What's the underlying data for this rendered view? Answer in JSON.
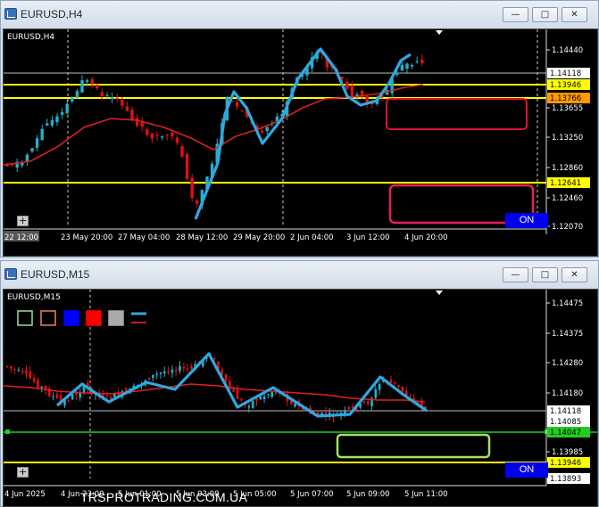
{
  "window_top": {
    "title": "EURUSD,H4",
    "symbol_label": "EURUSD,H4",
    "on_label": "ON",
    "price_levels": [
      "1.14440",
      "1.14118",
      "1.13946",
      "1.13766",
      "1.13655",
      "1.13250",
      "1.12860",
      "1.12641",
      "1.12460",
      "1.12070"
    ],
    "time_labels": [
      "22 12:00",
      "23 May 20:00",
      "27 May 04:00",
      "28 May 12:00",
      "29 May 20:00",
      "2 Jun 04:00",
      "3 Jun 12:00",
      "4 Jun 20:00"
    ],
    "colors": {
      "bull": "#21b0c8",
      "bear": "#e01010",
      "ma": "#e02020",
      "zigzag": "#2fa8e0",
      "level": "#ffff00",
      "box": "#e8205a"
    }
  },
  "window_bottom": {
    "title": "EURUSD,M15",
    "symbol_label": "EURUSD,M15",
    "on_label": "ON",
    "watermark": "TRSPROTRADING.COM.UA",
    "price_levels": [
      "1.14475",
      "1.14375",
      "1.14280",
      "1.14180",
      "1.14118",
      "1.14085",
      "1.14047",
      "1.13985",
      "1.13946",
      "1.13893"
    ],
    "time_labels": [
      "4 Jun 2025",
      "4 Jun 23:00",
      "5 Jun 01:00",
      "5 Jun 03:00",
      "5 Jun 05:00",
      "5 Jun 07:00",
      "5 Jun 09:00",
      "5 Jun 11:00"
    ],
    "swatches": [
      "outline-green",
      "outline-salmon",
      "blue",
      "red",
      "gray",
      "line-blue-red"
    ],
    "colors": {
      "bull": "#21b0c8",
      "bear": "#e01010",
      "ma": "#e02020",
      "zigzag": "#2fa8e0",
      "level": "#ffff00",
      "green_level": "#22cc22",
      "box": "#a8e060"
    }
  },
  "window_controls": {
    "minimize": "—",
    "maximize": "□",
    "close": "✕"
  }
}
